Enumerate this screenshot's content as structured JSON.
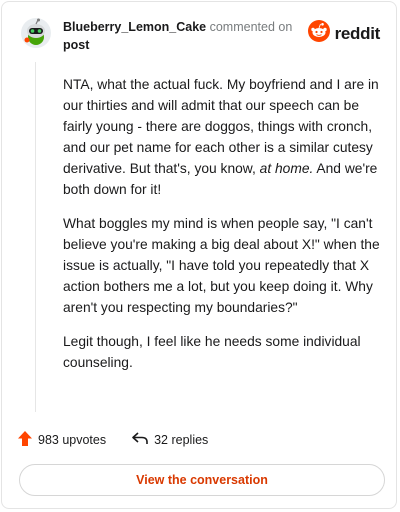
{
  "comment": {
    "username": "Blueberry_Lemon_Cake",
    "action_text": "commented on",
    "target_text": "post",
    "paragraphs": [
      {
        "before": "NTA, what the actual fuck. My boyfriend and I are in our thirties and will admit that our speech can be fairly young - there are doggos, things with cronch, and our pet name for each other is a similar cutesy derivative. But that's, you know, ",
        "emphasis": "at home.",
        "after": " And we're both down for it!"
      },
      {
        "text": "What boggles my mind is when people say, \"I can't believe you're making a big deal about X!\" when the issue is actually, \"I have told you repeatedly that X action bothers me a lot, but you keep doing it. Why aren't you respecting my boundaries?\""
      },
      {
        "text": "Legit though, I feel like he needs some individual counseling."
      }
    ]
  },
  "brand": {
    "logo_text": "reddit",
    "color": "#ff4500"
  },
  "stats": {
    "upvotes": "983 upvotes",
    "replies": "32 replies"
  },
  "cta": {
    "label": "View the conversation",
    "color": "#d93900"
  },
  "icons": {
    "avatar": "snoo-avatar-icon",
    "logo": "reddit-alien-icon",
    "upvote": "upvote-arrow-icon",
    "reply": "reply-arrow-icon"
  }
}
